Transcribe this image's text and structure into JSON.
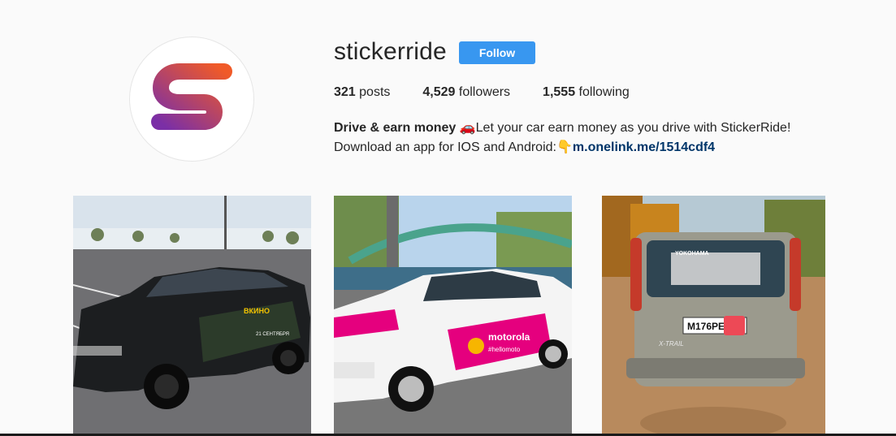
{
  "profile": {
    "username": "stickerride",
    "follow_label": "Follow",
    "avatar_letter": "S",
    "stats": {
      "posts_count": "321",
      "posts_label": "posts",
      "followers_count": "4,529",
      "followers_label": "followers",
      "following_count": "1,555",
      "following_label": "following"
    },
    "bio": {
      "name": "Drive & earn money",
      "car_emoji": "🚗",
      "line1_text": "Let your car earn money as you drive with StickerRide!",
      "line2_text": "Download an app for IOS and Android:",
      "point_emoji": "👇",
      "link": "m.onelink.me/1514cdf4"
    }
  },
  "posts": [
    {
      "car_color": "black",
      "wrap_text": "21 СЕНТЯБРЯ В КИНО"
    },
    {
      "car_color": "white",
      "wrap_text": "motorola #hellomoto"
    },
    {
      "car_color": "silver",
      "plate_text": "М176РЕ",
      "window_text": "YOKOHAMA",
      "badge_text": "X-TRAIL"
    }
  ],
  "colors": {
    "follow_button": "#3897f0",
    "link": "#003569",
    "avatar_gradient_start": "#f05a28",
    "avatar_gradient_end": "#7b2fa6",
    "wrap_pink": "#e5007e"
  }
}
